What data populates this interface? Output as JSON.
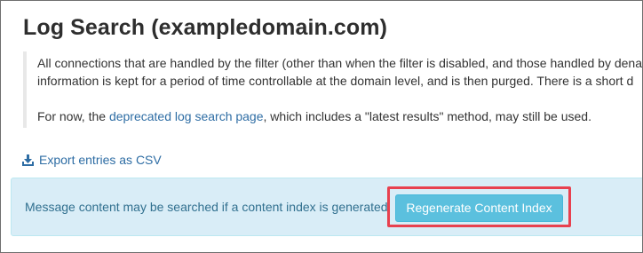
{
  "page": {
    "title_prefix": "Log Search",
    "title_domain": "(exampledomain.com)"
  },
  "description": {
    "line1": "All connections that are handled by the filter (other than when the filter is disabled, and those handled by dena",
    "line2": "information is kept for a period of time controllable at the domain level, and is then purged. There is a short d",
    "line3_before": "For now, the ",
    "line3_link": "deprecated log search page",
    "line3_after": ", which includes a \"latest results\" method, may still be used."
  },
  "export": {
    "label": "Export entries as CSV",
    "icon": "download-icon"
  },
  "content_index": {
    "message": "Message content may be searched if a content index is generated",
    "button_label": "Regenerate Content Index"
  },
  "colors": {
    "link": "#2e6da4",
    "info_bg": "#d9edf7",
    "info_text": "#31708f",
    "button_bg": "#5bc0de",
    "highlight": "#e8414f"
  }
}
